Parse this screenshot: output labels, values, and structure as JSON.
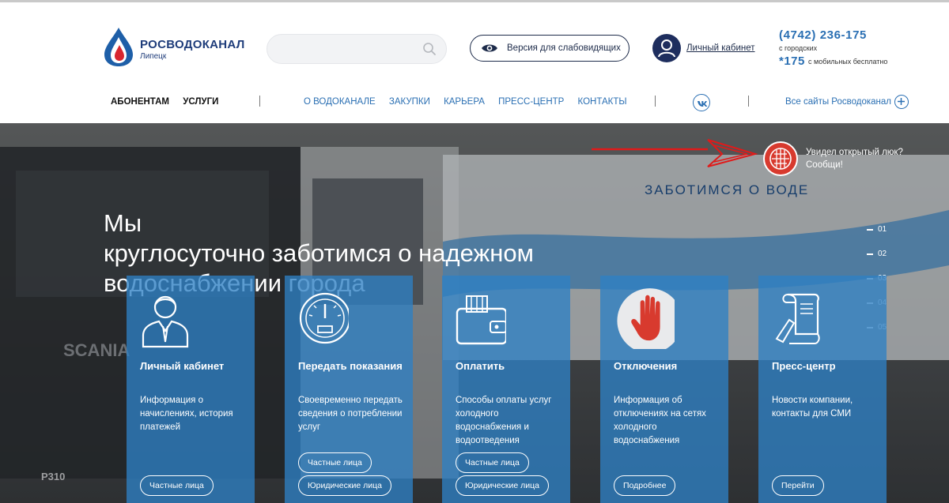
{
  "header": {
    "logo": {
      "name": "РОСВОДОКАНАЛ",
      "city": "Липецк"
    },
    "search": {
      "placeholder": ""
    },
    "low_vision_label": "Версия для слабовидящих",
    "cabinet_link": "Личный кабинет",
    "phone": "(4742) 236-175",
    "phone_note": "с городских",
    "short_number": "*175",
    "short_note": "с мобильных бесплатно"
  },
  "nav": {
    "left": [
      "АБОНЕНТАМ",
      "УСЛУГИ"
    ],
    "main": [
      "О ВОДОКАНАЛЕ",
      "ЗАКУПКИ",
      "КАРЬЕРА",
      "ПРЕСС-ЦЕНТР",
      "КОНТАКТЫ"
    ],
    "all_sites": "Все сайты Росводоканал"
  },
  "hero": {
    "title_lines": [
      "Мы",
      "круглосуточно заботимся о надежном",
      "водоснабжении города"
    ],
    "truck_slogan": "ЗАБОТИМСЯ О ВОДЕ",
    "truck_plate": "P310",
    "truck_brand": "SCANIA",
    "slides": [
      "01",
      "02",
      "03",
      "04",
      "05"
    ],
    "hatch_report": {
      "line1": "Увидел открытый люк?",
      "line2": "Сообщи!"
    }
  },
  "cards": [
    {
      "title": "Личный кабинет",
      "desc": "Информация о начислениях, история платежей",
      "buttons": [
        "Частные лица"
      ]
    },
    {
      "title": "Передать показания",
      "desc": "Своевременно передать сведения о потреблении услуг",
      "buttons": [
        "Частные лица",
        "Юридические лица"
      ]
    },
    {
      "title": "Оплатить",
      "desc": "Способы оплаты услуг холодного водоснабжения и водоотведения",
      "buttons": [
        "Частные лица",
        "Юридические лица"
      ]
    },
    {
      "title": "Отключения",
      "desc": "Информация об отключениях на сетях холодного водоснабжения",
      "buttons": [
        "Подробнее"
      ]
    },
    {
      "title": "Пресс-центр",
      "desc": "Новости компании, контакты для СМИ",
      "buttons": [
        "Перейти"
      ]
    }
  ],
  "colors": {
    "brand_blue": "#2a6fb3",
    "brand_dark": "#1e3c7a",
    "card_blue": "#2e80c4",
    "alert_red": "#d83a2e",
    "annotation_arrow": "#e01a1a"
  },
  "icons": {
    "search": "search-icon",
    "low_vision": "eye-icon",
    "profile": "user-icon",
    "social": "vk-icon",
    "all_sites": "plus-icon",
    "hatch": "manhole-icon"
  }
}
